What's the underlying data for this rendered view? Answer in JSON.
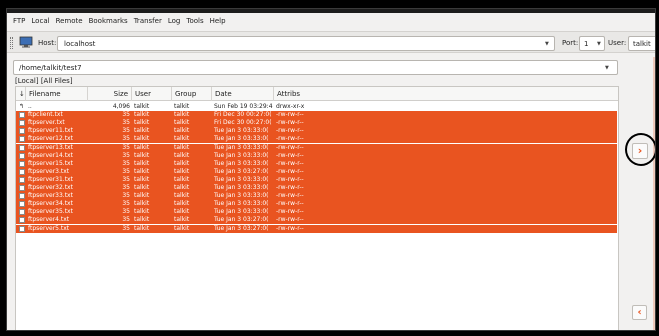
{
  "menu": [
    "FTP",
    "Local",
    "Remote",
    "Bookmarks",
    "Transfer",
    "Log",
    "Tools",
    "Help"
  ],
  "hostbar": {
    "host_label": "Host:",
    "host_value": "localhost",
    "port_label": "Port:",
    "port_value": "1",
    "user_label": "User:",
    "user_value": "talkit"
  },
  "local": {
    "path": "/home/talkit/test7",
    "filter": "[Local] [All Files]",
    "columns": [
      "Filename",
      "Size",
      "User",
      "Group",
      "Date",
      "Attribs"
    ],
    "rows": [
      {
        "name": "..",
        "size": "4,096",
        "user": "talkit",
        "group": "talkit",
        "date": "Sun Feb 19 03:29:4",
        "attribs": "drwx-xr-x",
        "selected": false
      },
      {
        "name": "ftpclient.txt",
        "size": "35",
        "user": "talkit",
        "group": "talkit",
        "date": "Fri Dec 30 00:27:0(",
        "attribs": "-rw-rw-r--",
        "selected": true
      },
      {
        "name": "ftpserver.txt",
        "size": "35",
        "user": "talkit",
        "group": "talkit",
        "date": "Fri Dec 30 00:27:0(",
        "attribs": "-rw-rw-r--",
        "selected": true
      },
      {
        "name": "ftpserver11.txt",
        "size": "35",
        "user": "talkit",
        "group": "talkit",
        "date": "Tue Jan 3 03:33:0(",
        "attribs": "-rw-rw-r--",
        "selected": true
      },
      {
        "name": "ftpserver12.txt",
        "size": "35",
        "user": "talkit",
        "group": "talkit",
        "date": "Tue Jan 3 03:33:0(",
        "attribs": "-rw-rw-r--",
        "selected": true
      },
      {
        "name": "ftpserver13.txt",
        "size": "35",
        "user": "talkit",
        "group": "talkit",
        "date": "Tue Jan 3 03:33:0(",
        "attribs": "-rw-rw-r--",
        "selected": true
      },
      {
        "name": "ftpserver14.txt",
        "size": "35",
        "user": "talkit",
        "group": "talkit",
        "date": "Tue Jan 3 03:33:0(",
        "attribs": "-rw-rw-r--",
        "selected": true
      },
      {
        "name": "ftpserver15.txt",
        "size": "35",
        "user": "talkit",
        "group": "talkit",
        "date": "Tue Jan 3 03:33:0(",
        "attribs": "-rw-rw-r--",
        "selected": true
      },
      {
        "name": "ftpserver3.txt",
        "size": "35",
        "user": "talkit",
        "group": "talkit",
        "date": "Tue Jan 3 03:27:0(",
        "attribs": "-rw-rw-r--",
        "selected": true
      },
      {
        "name": "ftpserver31.txt",
        "size": "35",
        "user": "talkit",
        "group": "talkit",
        "date": "Tue Jan 3 03:33:0(",
        "attribs": "-rw-rw-r--",
        "selected": true
      },
      {
        "name": "ftpserver32.txt",
        "size": "35",
        "user": "talkit",
        "group": "talkit",
        "date": "Tue Jan 3 03:33:0(",
        "attribs": "-rw-rw-r--",
        "selected": true
      },
      {
        "name": "ftpserver33.txt",
        "size": "35",
        "user": "talkit",
        "group": "talkit",
        "date": "Tue Jan 3 03:33:0(",
        "attribs": "-rw-rw-r--",
        "selected": true
      },
      {
        "name": "ftpserver34.txt",
        "size": "35",
        "user": "talkit",
        "group": "talkit",
        "date": "Tue Jan 3 03:33:0(",
        "attribs": "-rw-rw-r--",
        "selected": true
      },
      {
        "name": "ftpserver35.txt",
        "size": "35",
        "user": "talkit",
        "group": "talkit",
        "date": "Tue Jan 3 03:33:0(",
        "attribs": "-rw-rw-r--",
        "selected": true
      },
      {
        "name": "ftpserver4.txt",
        "size": "35",
        "user": "talkit",
        "group": "talkit",
        "date": "Tue Jan 3 03:27:0(",
        "attribs": "-rw-rw-r--",
        "selected": true
      },
      {
        "name": "ftpserver5.txt",
        "size": "35",
        "user": "talkit",
        "group": "talkit",
        "date": "Tue Jan 3 03:27:0(",
        "attribs": "-rw-rw-r--",
        "selected": true
      }
    ]
  },
  "icons": {
    "transfer": "chevron-right-icon",
    "back": "chevron-left-icon",
    "parent_dir": "up-arrow-icon",
    "host": "monitor-icon"
  },
  "colors": {
    "selection": "#e95420",
    "window": "#f2f1f0"
  }
}
